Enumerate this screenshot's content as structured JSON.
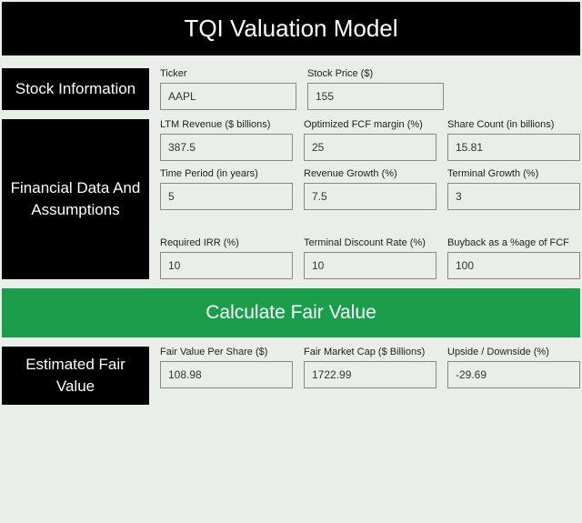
{
  "title": "TQI Valuation Model",
  "sections": {
    "stock": {
      "heading": "Stock Information",
      "ticker_label": "Ticker",
      "ticker_value": "AAPL",
      "price_label": "Stock Price ($)",
      "price_value": "155"
    },
    "assumptions": {
      "heading": "Financial Data And Assumptions",
      "ltm_rev_label": "LTM Revenue ($ billions)",
      "ltm_rev_value": "387.5",
      "fcf_margin_label": "Optimized FCF margin (%)",
      "fcf_margin_value": "25",
      "share_count_label": "Share Count (in billions)",
      "share_count_value": "15.81",
      "time_period_label": "Time Period (in years)",
      "time_period_value": "5",
      "rev_growth_label": "Revenue Growth (%)",
      "rev_growth_value": "7.5",
      "term_growth_label": "Terminal Growth (%)",
      "term_growth_value": "3",
      "irr_label": "Required IRR (%)",
      "irr_value": "10",
      "term_disc_label": "Terminal Discount Rate (%)",
      "term_disc_value": "10",
      "buyback_label": "Buyback as a %age of FCF",
      "buyback_value": "100"
    },
    "calculate_label": "Calculate Fair Value",
    "results": {
      "heading": "Estimated Fair Value",
      "fvps_label": "Fair Value Per Share ($)",
      "fvps_value": "108.98",
      "fmc_label": "Fair Market Cap ($ Billions)",
      "fmc_value": "1722.99",
      "upside_label": "Upside / Downside (%)",
      "upside_value": "-29.69"
    }
  }
}
